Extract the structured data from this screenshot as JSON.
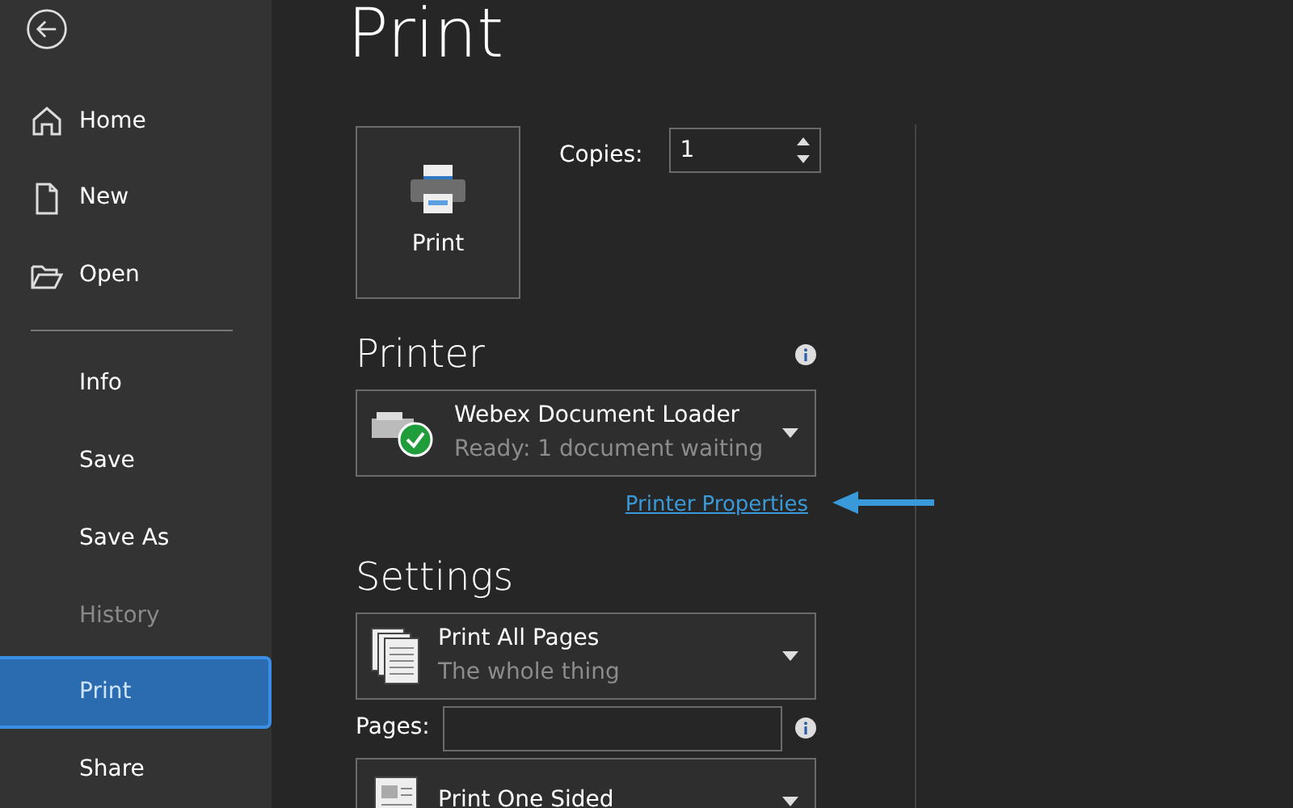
{
  "sidebar": {
    "items": [
      {
        "label": "Home",
        "kind": "home",
        "selected": false,
        "disabled": false
      },
      {
        "label": "New",
        "kind": "new",
        "selected": false,
        "disabled": false
      },
      {
        "label": "Open",
        "kind": "open",
        "selected": false,
        "disabled": false
      },
      {
        "kind": "divider"
      },
      {
        "label": "Info",
        "kind": "plain",
        "selected": false,
        "disabled": false
      },
      {
        "label": "Save",
        "kind": "plain",
        "selected": false,
        "disabled": false
      },
      {
        "label": "Save As",
        "kind": "plain",
        "selected": false,
        "disabled": false
      },
      {
        "label": "History",
        "kind": "plain",
        "selected": false,
        "disabled": true
      },
      {
        "label": "Print",
        "kind": "plain",
        "selected": true,
        "disabled": false
      },
      {
        "label": "Share",
        "kind": "plain",
        "selected": false,
        "disabled": false
      }
    ]
  },
  "page_title": "Print",
  "print_button": {
    "label": "Print"
  },
  "copies": {
    "label": "Copies:",
    "value": "1"
  },
  "printer": {
    "heading": "Printer",
    "name": "Webex Document Loader",
    "status": "Ready: 1 document waiting",
    "properties_link": "Printer Properties"
  },
  "settings": {
    "heading": "Settings",
    "dropdowns": [
      {
        "kind": "pages",
        "title": "Print All Pages",
        "subtitle": "The whole thing"
      },
      {
        "kind": "pages_field",
        "label": "Pages:"
      },
      {
        "kind": "sided",
        "title": "Print One Sided"
      }
    ]
  }
}
